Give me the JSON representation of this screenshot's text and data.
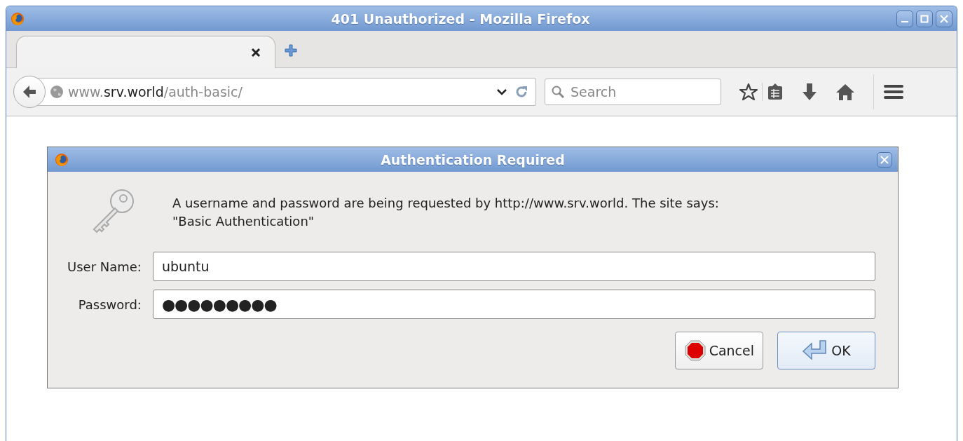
{
  "window": {
    "title": "401 Unauthorized - Mozilla Firefox"
  },
  "tabs": [
    {
      "selected": true
    }
  ],
  "address_bar": {
    "url_prefix": "www.",
    "url_domain": "srv.world",
    "url_path": "/auth-basic/"
  },
  "search": {
    "placeholder": "Search"
  },
  "dialog": {
    "title": "Authentication Required",
    "message": "A username and password are being requested by http://www.srv.world. The site says: \"Basic Authentication\"",
    "fields": [
      {
        "label": "User Name:",
        "value": "ubuntu",
        "kind": "text"
      },
      {
        "label": "Password:",
        "value": "●●●●●●●●●",
        "kind": "password"
      }
    ],
    "buttons": [
      {
        "label": "Cancel",
        "kind": "cancel"
      },
      {
        "label": "OK",
        "kind": "ok"
      }
    ]
  }
}
